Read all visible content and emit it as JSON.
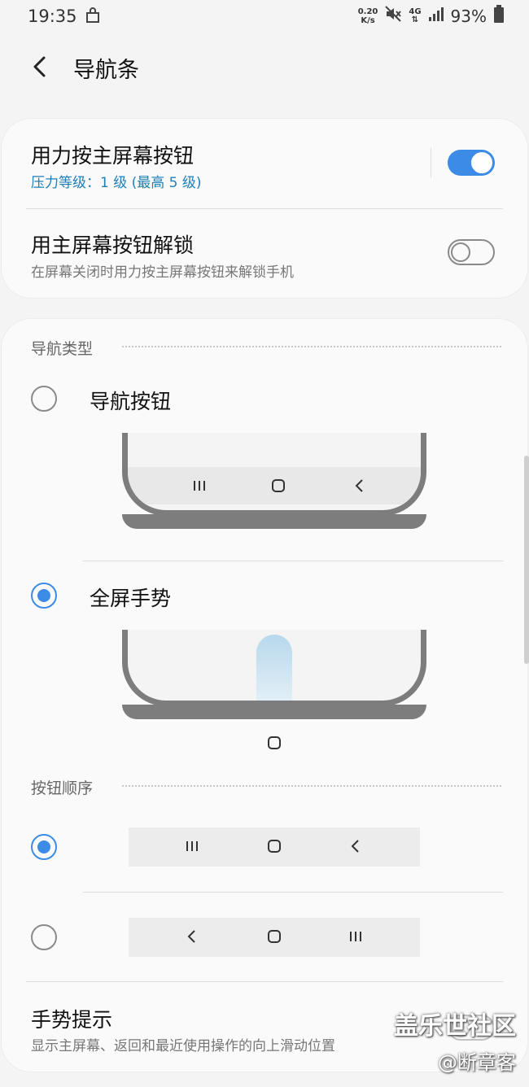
{
  "status_bar": {
    "time": "19:35",
    "net_speed_value": "0.20",
    "net_speed_unit": "K/s",
    "network": "4G",
    "battery": "93%"
  },
  "header": {
    "title": "导航条"
  },
  "settings": {
    "press_home": {
      "title": "用力按主屏幕按钮",
      "subtitle": "压力等级：1 级 (最高 5 级)",
      "enabled": true
    },
    "unlock_home": {
      "title": "用主屏幕按钮解锁",
      "subtitle": "在屏幕关闭时用力按主屏幕按钮来解锁手机",
      "enabled": false
    }
  },
  "nav_type": {
    "label": "导航类型",
    "options": [
      {
        "label": "导航按钮",
        "selected": false
      },
      {
        "label": "全屏手势",
        "selected": true
      }
    ]
  },
  "button_order": {
    "label": "按钮顺序",
    "options": [
      {
        "order": [
          "recents",
          "home",
          "back"
        ],
        "selected": true
      },
      {
        "order": [
          "back",
          "home",
          "recents"
        ],
        "selected": false
      }
    ]
  },
  "gesture_hint": {
    "title": "手势提示",
    "subtitle": "显示主屏幕、返回和最近使用操作的向上滑动位置"
  },
  "watermark": {
    "line1": "盖乐世社区",
    "line2": "@断章客"
  },
  "colors": {
    "accent": "#3c8be6",
    "subtitle_blue": "#1f7fb8",
    "background": "#f4f4f4"
  }
}
